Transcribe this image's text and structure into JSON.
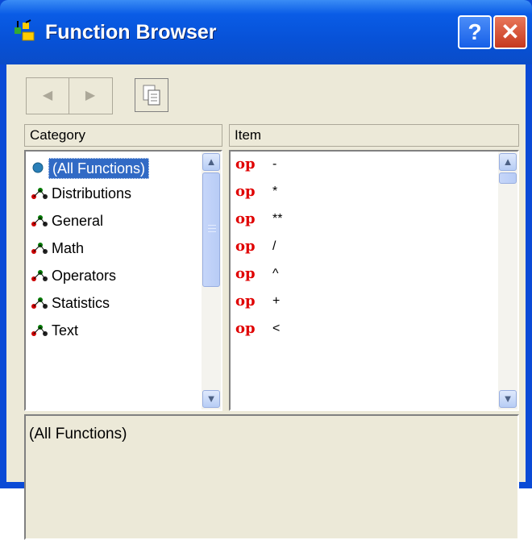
{
  "window": {
    "title": "Function Browser",
    "help_label": "?",
    "close_label": "✕"
  },
  "toolbar": {
    "back_label": "◀",
    "forward_label": "▶"
  },
  "category": {
    "header": "Category",
    "items": [
      {
        "label": "(All Functions)",
        "icon": "circle-icon",
        "selected": true
      },
      {
        "label": "Distributions",
        "icon": "molecule-icon"
      },
      {
        "label": "General",
        "icon": "molecule-icon"
      },
      {
        "label": "Math",
        "icon": "molecule-icon"
      },
      {
        "label": "Operators",
        "icon": "molecule-icon"
      },
      {
        "label": "Statistics",
        "icon": "molecule-icon"
      },
      {
        "label": "Text",
        "icon": "molecule-icon"
      }
    ]
  },
  "item": {
    "header": "Item",
    "items": [
      {
        "prefix": "op",
        "symbol": "-"
      },
      {
        "prefix": "op",
        "symbol": "*"
      },
      {
        "prefix": "op",
        "symbol": "**"
      },
      {
        "prefix": "op",
        "symbol": "/"
      },
      {
        "prefix": "op",
        "symbol": "^"
      },
      {
        "prefix": "op",
        "symbol": "+"
      },
      {
        "prefix": "op",
        "symbol": "<"
      }
    ]
  },
  "description": {
    "text": "(All Functions)"
  },
  "colors": {
    "titlebar": "#0752d8",
    "selection": "#316ac5",
    "op_red": "#e00000",
    "face": "#ece9d8"
  }
}
